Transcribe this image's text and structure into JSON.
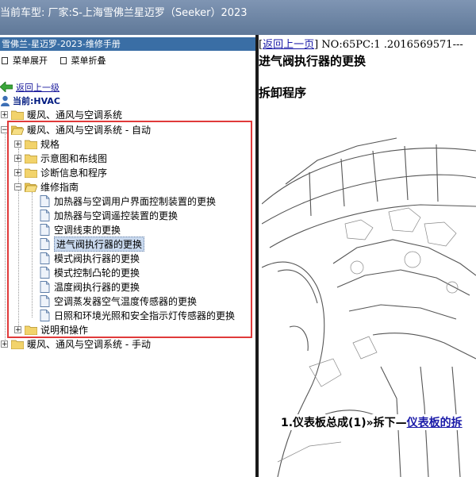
{
  "header": {
    "vehicle_label": "当前车型: 厂家:S-上海雪佛兰星迈罗（Seeker）2023"
  },
  "sidebar": {
    "title": "雪佛兰-星迈罗-2023-维修手册",
    "toolbar": {
      "expand": "菜单展开",
      "collapse": "菜单折叠"
    },
    "back_link": "返回上一级",
    "current": "当前:HVAC",
    "tree": {
      "hvac": "暖风、通风与空调系统",
      "hvac_auto": "暖风、通风与空调系统 - 自动",
      "specs": "规格",
      "diagrams": "示意图和布线图",
      "diag_info": "诊断信息和程序",
      "repair": "维修指南",
      "docs": [
        "加热器与空调用户界面控制装置的更换",
        "加热器与空调遥控装置的更换",
        "空调线束的更换",
        "进气阀执行器的更换",
        "模式阀执行器的更换",
        "模式控制凸轮的更换",
        "温度阀执行器的更换",
        "空调蒸发器空气温度传感器的更换",
        "日照和环境光照和安全指示灯传感器的更换"
      ],
      "desc_op": "说明和操作",
      "hvac_manual": "暖风、通风与空调系统 - 手动"
    }
  },
  "content": {
    "back_link": "返回上一页",
    "doc_no": "] NO:65PC:1 .2016569571---",
    "title": "进气阀执行器的更换",
    "subtitle": "拆卸程序",
    "step_text": "1.仪表板总成(1)»拆下—",
    "step_link": "仪表板的拆"
  },
  "colors": {
    "header_bg": "#6f86a6",
    "panel_title_bg": "#3a6ea5",
    "highlight_box": "#e03a3a",
    "link": "#1a1aa8",
    "selected_bg": "#c9d9ee"
  }
}
